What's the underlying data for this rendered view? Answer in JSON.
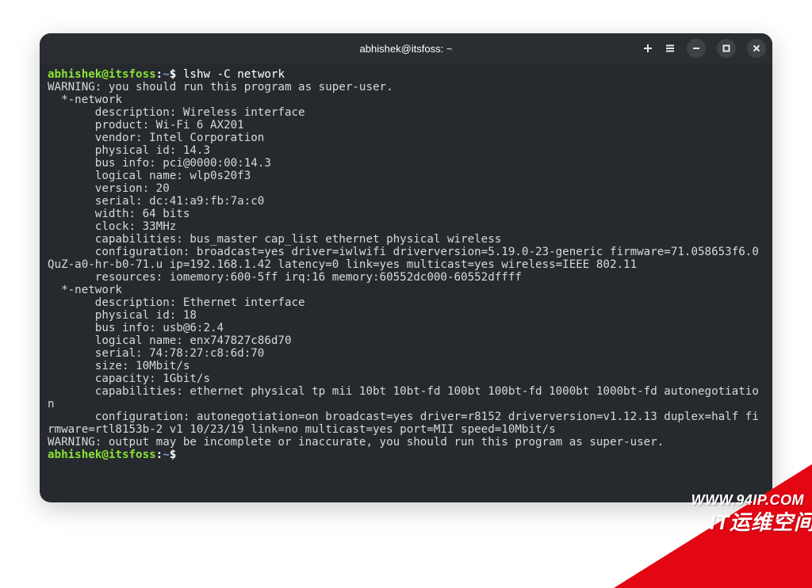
{
  "titlebar": {
    "title": "abhishek@itsfoss: ~"
  },
  "prompt": {
    "user_host": "abhishek@itsfoss",
    "colon": ":",
    "path": "~",
    "dollar": "$"
  },
  "command": "lshw -C network",
  "output_lines": [
    "WARNING: you should run this program as super-user.",
    "  *-network",
    "       description: Wireless interface",
    "       product: Wi-Fi 6 AX201",
    "       vendor: Intel Corporation",
    "       physical id: 14.3",
    "       bus info: pci@0000:00:14.3",
    "       logical name: wlp0s20f3",
    "       version: 20",
    "       serial: dc:41:a9:fb:7a:c0",
    "       width: 64 bits",
    "       clock: 33MHz",
    "       capabilities: bus_master cap_list ethernet physical wireless",
    "       configuration: broadcast=yes driver=iwlwifi driverversion=5.19.0-23-generic firmware=71.058653f6.0 QuZ-a0-hr-b0-71.u ip=192.168.1.42 latency=0 link=yes multicast=yes wireless=IEEE 802.11",
    "       resources: iomemory:600-5ff irq:16 memory:60552dc000-60552dffff",
    "  *-network",
    "       description: Ethernet interface",
    "       physical id: 18",
    "       bus info: usb@6:2.4",
    "       logical name: enx747827c86d70",
    "       serial: 74:78:27:c8:6d:70",
    "       size: 10Mbit/s",
    "       capacity: 1Gbit/s",
    "       capabilities: ethernet physical tp mii 10bt 10bt-fd 100bt 100bt-fd 1000bt 1000bt-fd autonegotiation",
    "       configuration: autonegotiation=on broadcast=yes driver=r8152 driverversion=v1.12.13 duplex=half firmware=rtl8153b-2 v1 10/23/19 link=no multicast=yes port=MII speed=10Mbit/s",
    "WARNING: output may be incomplete or inaccurate, you should run this program as super-user."
  ],
  "watermark": {
    "url": "WWW.94IP.COM",
    "name": "IT运维空间"
  }
}
